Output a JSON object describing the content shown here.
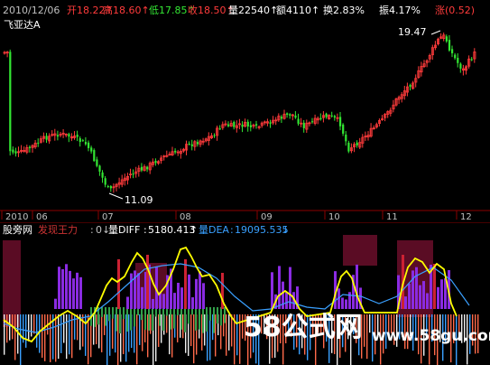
{
  "header": {
    "date": "2010/12/06",
    "items": [
      {
        "label": "开",
        "value": "18.22",
        "arrow": "↑",
        "color": "#ff3b3b"
      },
      {
        "label": "高",
        "value": "18.60",
        "arrow": "↑",
        "color": "#ff3b3b"
      },
      {
        "label": "低",
        "value": "17.85",
        "arrow": "↑",
        "color": "#33e633"
      },
      {
        "label": "收",
        "value": "18.50",
        "arrow": "↑",
        "color": "#ff3b3b"
      },
      {
        "label": "量",
        "value": "22540",
        "arrow": "↑",
        "color": "#ffffff"
      },
      {
        "label": "额",
        "value": "4110",
        "arrow": "↑",
        "color": "#ffffff"
      },
      {
        "label": "换",
        "value": "2.83%",
        "arrow": "",
        "color": "#ffffff"
      },
      {
        "label": "振",
        "value": "4.17%",
        "arrow": "",
        "color": "#ffffff"
      },
      {
        "label": "涨",
        "value": "(0.52)",
        "arrow": "",
        "color": "#ff3b3b"
      }
    ]
  },
  "stock": {
    "name": "飞亚达A"
  },
  "price_annotations": {
    "high": "19.47",
    "low": "11.09"
  },
  "time_axis": {
    "labels": [
      "2010",
      "06",
      "07",
      "08",
      "09",
      "10",
      "11",
      "12"
    ]
  },
  "indicator_bar": {
    "source": "股旁网",
    "name": "发现王力",
    "zero_value": "0",
    "diff_label": "量DIFF",
    "diff_value": "5180.413",
    "dea_label": "量DEA",
    "dea_value": "19095.535"
  },
  "watermark": {
    "brand": "58公式网",
    "url": "www.58gu.com"
  },
  "colors": {
    "background": "#000000",
    "rise": "#ff3b3b",
    "fall": "#33e633",
    "yellow": "#ffff00",
    "blue": "#3aa0ff",
    "axis_text": "#c0c0c0",
    "purple": "#8a2be2",
    "maroon": "#7a1030"
  }
}
